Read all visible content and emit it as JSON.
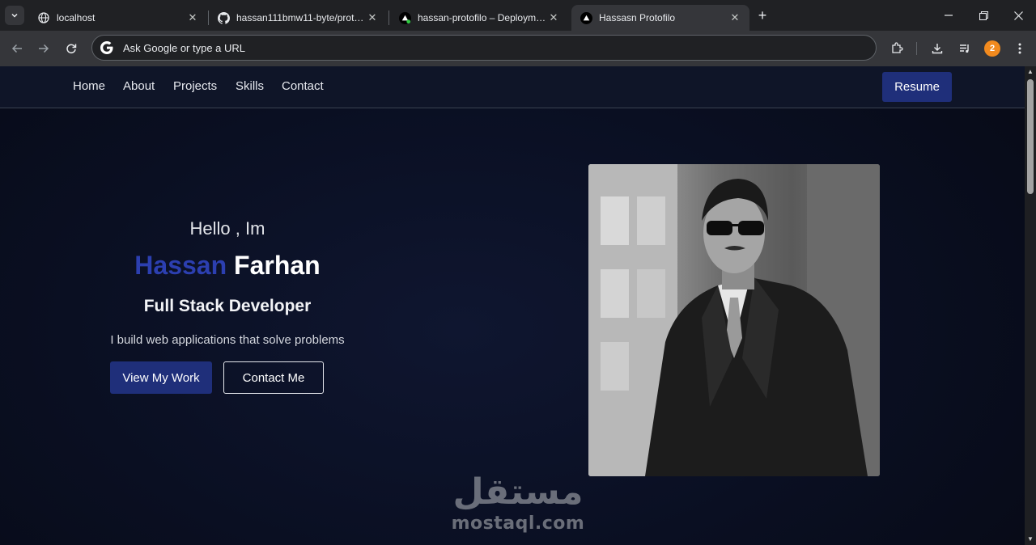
{
  "browser": {
    "tabs": [
      {
        "title": "localhost",
        "icon": "globe-icon",
        "active": false
      },
      {
        "title": "hassan111bmw11-byte/protofilo",
        "icon": "github-icon",
        "active": false
      },
      {
        "title": "hassan-protofilo – Deployment",
        "icon": "vercel-icon",
        "active": false
      },
      {
        "title": "Hassasn Protofilo",
        "icon": "vercel-icon",
        "active": true
      }
    ],
    "omnibox_placeholder": "Ask Google or type a URL",
    "profile_initial": "2",
    "avatar_color": "#f28a1e"
  },
  "site": {
    "nav": [
      "Home",
      "About",
      "Projects",
      "Skills",
      "Contact"
    ],
    "resume_label": "Resume",
    "greeting": "Hello , Im",
    "first_name": "Hassan",
    "last_name": "Farhan",
    "role": "Full Stack Developer",
    "tagline": "I build web applications that solve problems",
    "primary_cta": "View My Work",
    "secondary_cta": "Contact Me",
    "accent_color": "#2c3fb0",
    "button_color": "#1f2f7a"
  },
  "watermark": {
    "arabic": "مستقل",
    "latin": "mostaql.com"
  }
}
